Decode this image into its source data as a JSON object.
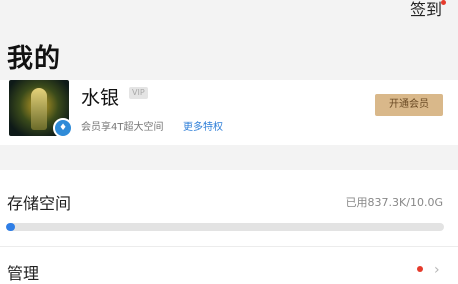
{
  "header": {
    "checkin_label": "签到",
    "title": "我的"
  },
  "profile": {
    "username": "水银",
    "vip_badge": "VIP",
    "member_desc": "会员享4T超大空间",
    "more_link": "更多特权",
    "open_vip_label": "开通会员"
  },
  "storage": {
    "title": "存储空间",
    "usage": "已用837.3K/10.0G",
    "used_fraction": 0.02
  },
  "manage": {
    "label": "管理",
    "chevron": "›"
  },
  "colors": {
    "accent": "#2f7ee6",
    "badge_red": "#e53b2c",
    "vip_gold": "#d9b88a"
  }
}
